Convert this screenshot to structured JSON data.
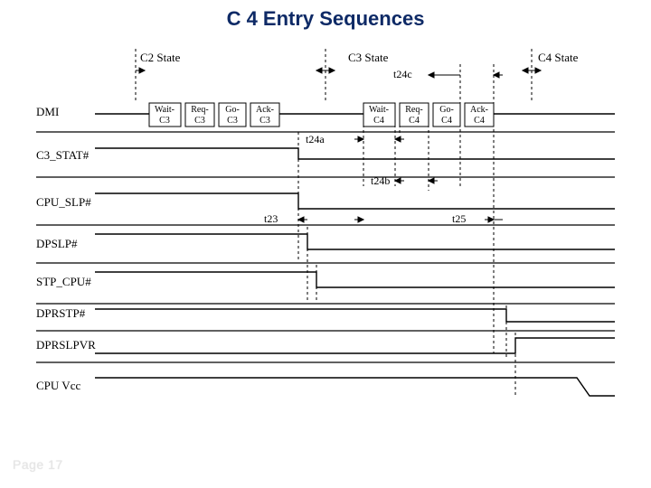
{
  "title": "C 4 Entry Sequences",
  "page": "Page 17",
  "states": {
    "c2": "C2 State",
    "c3": "C3 State",
    "c4": "C4 State"
  },
  "signals": {
    "dmi": "DMI",
    "c3stat": "C3_STAT#",
    "cpuslp": "CPU_SLP#",
    "dpslp": "DPSLP#",
    "stpcpu": "STP_CPU#",
    "dprstp": "DPRSTP#",
    "dprslpvr": "DPRSLPVR",
    "cpuvcc": "CPU Vcc"
  },
  "msgs": {
    "wait_c3_a": "Wait-",
    "wait_c3_b": "C3",
    "req_c3_a": "Req-",
    "req_c3_b": "C3",
    "go_c3_a": "Go-",
    "go_c3_b": "C3",
    "ack_c3_a": "Ack-",
    "ack_c3_b": "C3",
    "wait_c4_a": "Wait-",
    "wait_c4_b": "C4",
    "req_c4_a": "Req-",
    "req_c4_b": "C4",
    "go_c4_a": "Go-",
    "go_c4_b": "C4",
    "ack_c4_a": "Ack-",
    "ack_c4_b": "C4"
  },
  "timing": {
    "t23": "t23",
    "t24a": "t24a",
    "t24b": "t24b",
    "t24c": "t24c",
    "t25": "t25"
  }
}
